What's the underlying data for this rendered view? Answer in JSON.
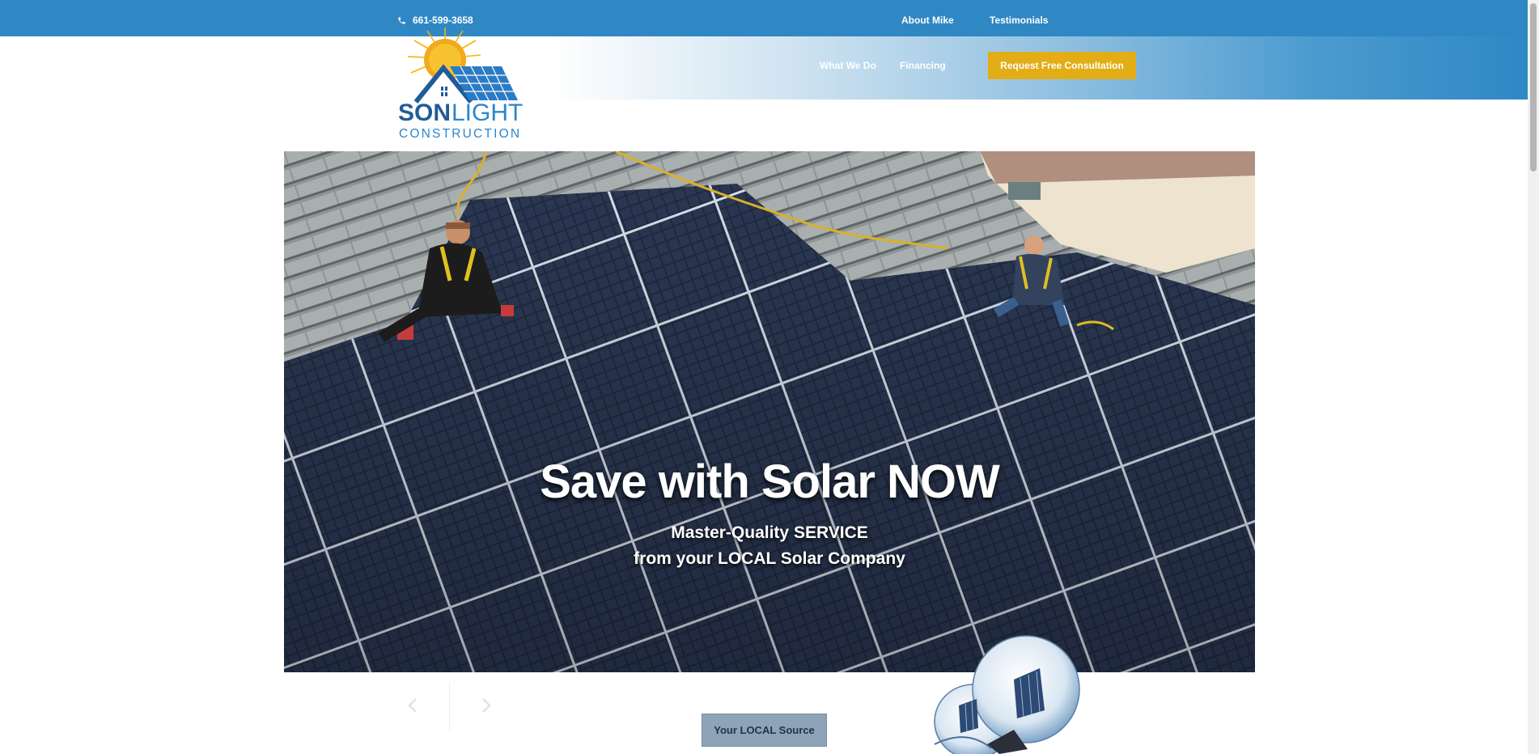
{
  "topbar": {
    "phone": "661-599-3658",
    "icon": "phone-icon",
    "links": [
      "About Mike",
      "Testimonials"
    ]
  },
  "nav": {
    "links": [
      "What We Do",
      "Financing"
    ],
    "cta_label": "Request Free Consultation"
  },
  "logo": {
    "brand_primary": "SON",
    "brand_secondary": "LIGHT",
    "tagline": "CONSTRUCTION"
  },
  "hero": {
    "title": "Save with Solar NOW",
    "subtitle_line1": "Master-Quality SERVICE",
    "subtitle_line2": "from your LOCAL Solar Company",
    "image_subject": "Two installers mounting solar panels on a tiled roof"
  },
  "carousel": {
    "prev_icon": "chevron-left-icon",
    "next_icon": "chevron-right-icon"
  },
  "below": {
    "button_label": "Your LOCAL Source",
    "illustration": "solar-lightbulb-icon"
  },
  "colors": {
    "brand_blue": "#2f88c4",
    "cta_yellow": "#e2ad17",
    "local_button": "#8fa3b8",
    "logo_navy": "#1f5c99",
    "logo_sun": "#f3a81d"
  }
}
